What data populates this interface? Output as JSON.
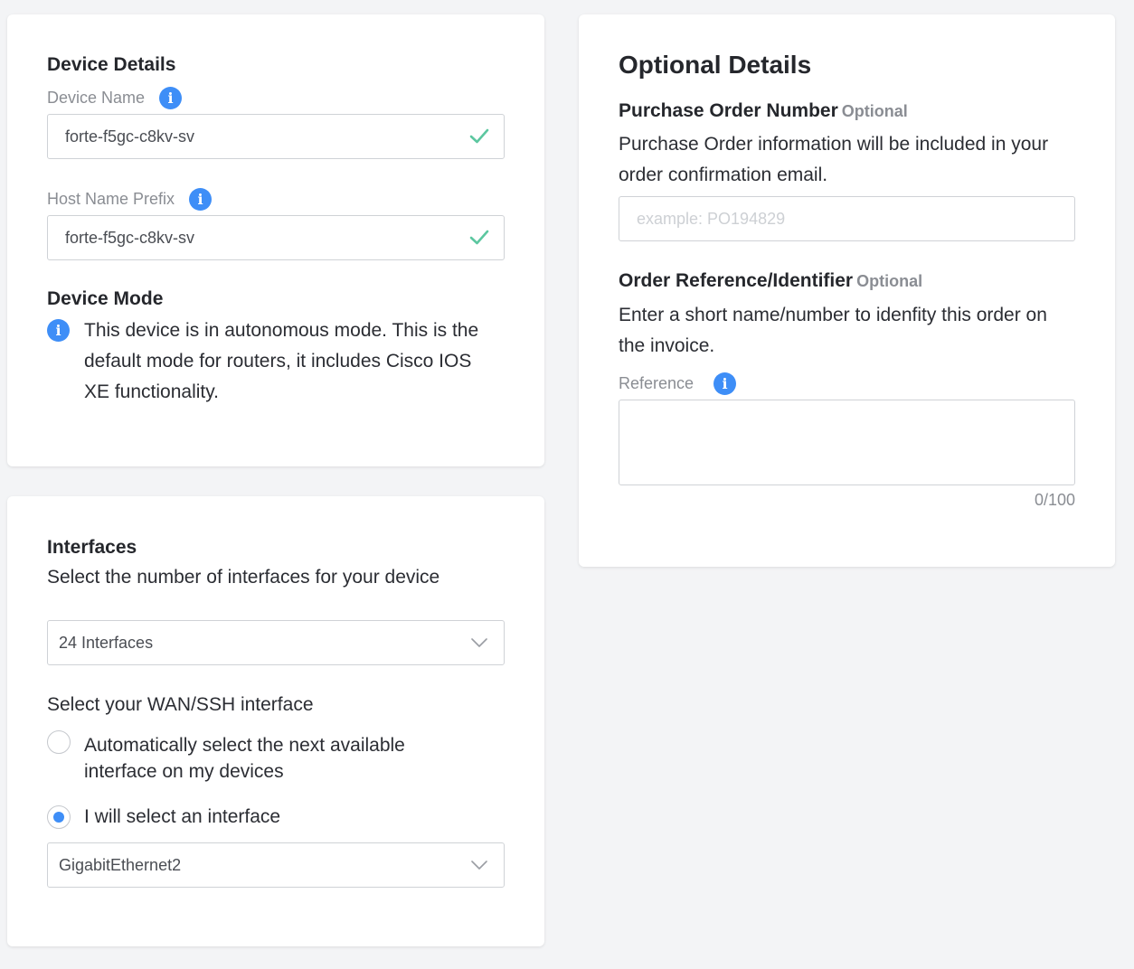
{
  "device_details": {
    "title": "Device Details",
    "device_name_label": "Device Name",
    "device_name_value": "forte-f5gc-c8kv-sv",
    "host_name_prefix_label": "Host Name Prefix",
    "host_name_prefix_value": "forte-f5gc-c8kv-sv",
    "device_mode_title": "Device Mode",
    "device_mode_line1": "This device is in autonomous mode. This is the",
    "device_mode_line2": "default mode for routers, it includes Cisco IOS",
    "device_mode_line3": "XE functionality."
  },
  "interfaces": {
    "title": "Interfaces",
    "subtitle": "Select the number of interfaces for your device",
    "count_selected": "24 Interfaces",
    "wan_ssh_label": "Select your WAN/SSH interface",
    "option_auto_line1": "Automatically select the next available",
    "option_auto_line2": "interface on my devices",
    "option_auto_selected": false,
    "option_manual": "I will select an interface",
    "option_manual_selected": true,
    "interface_selected": "GigabitEthernet2"
  },
  "optional_details": {
    "title": "Optional Details",
    "po_title": "Purchase Order Number",
    "optional_tag": "Optional",
    "po_desc_line1": "Purchase Order information will be included in your",
    "po_desc_line2": "order confirmation email.",
    "po_placeholder": "example: PO194829",
    "ref_title": "Order Reference/Identifier",
    "ref_desc_line1": "Enter a short name/number to idenfity this order on",
    "ref_desc_line2": "the invoice.",
    "reference_label": "Reference",
    "reference_value": "",
    "counter": "0/100"
  },
  "icons": {
    "info": "info-icon",
    "check": "check-icon",
    "chevron": "chevron-down-icon"
  },
  "colors": {
    "accent": "#3e8ef7",
    "valid_check": "#5cc7a0",
    "background": "#f3f4f6"
  }
}
